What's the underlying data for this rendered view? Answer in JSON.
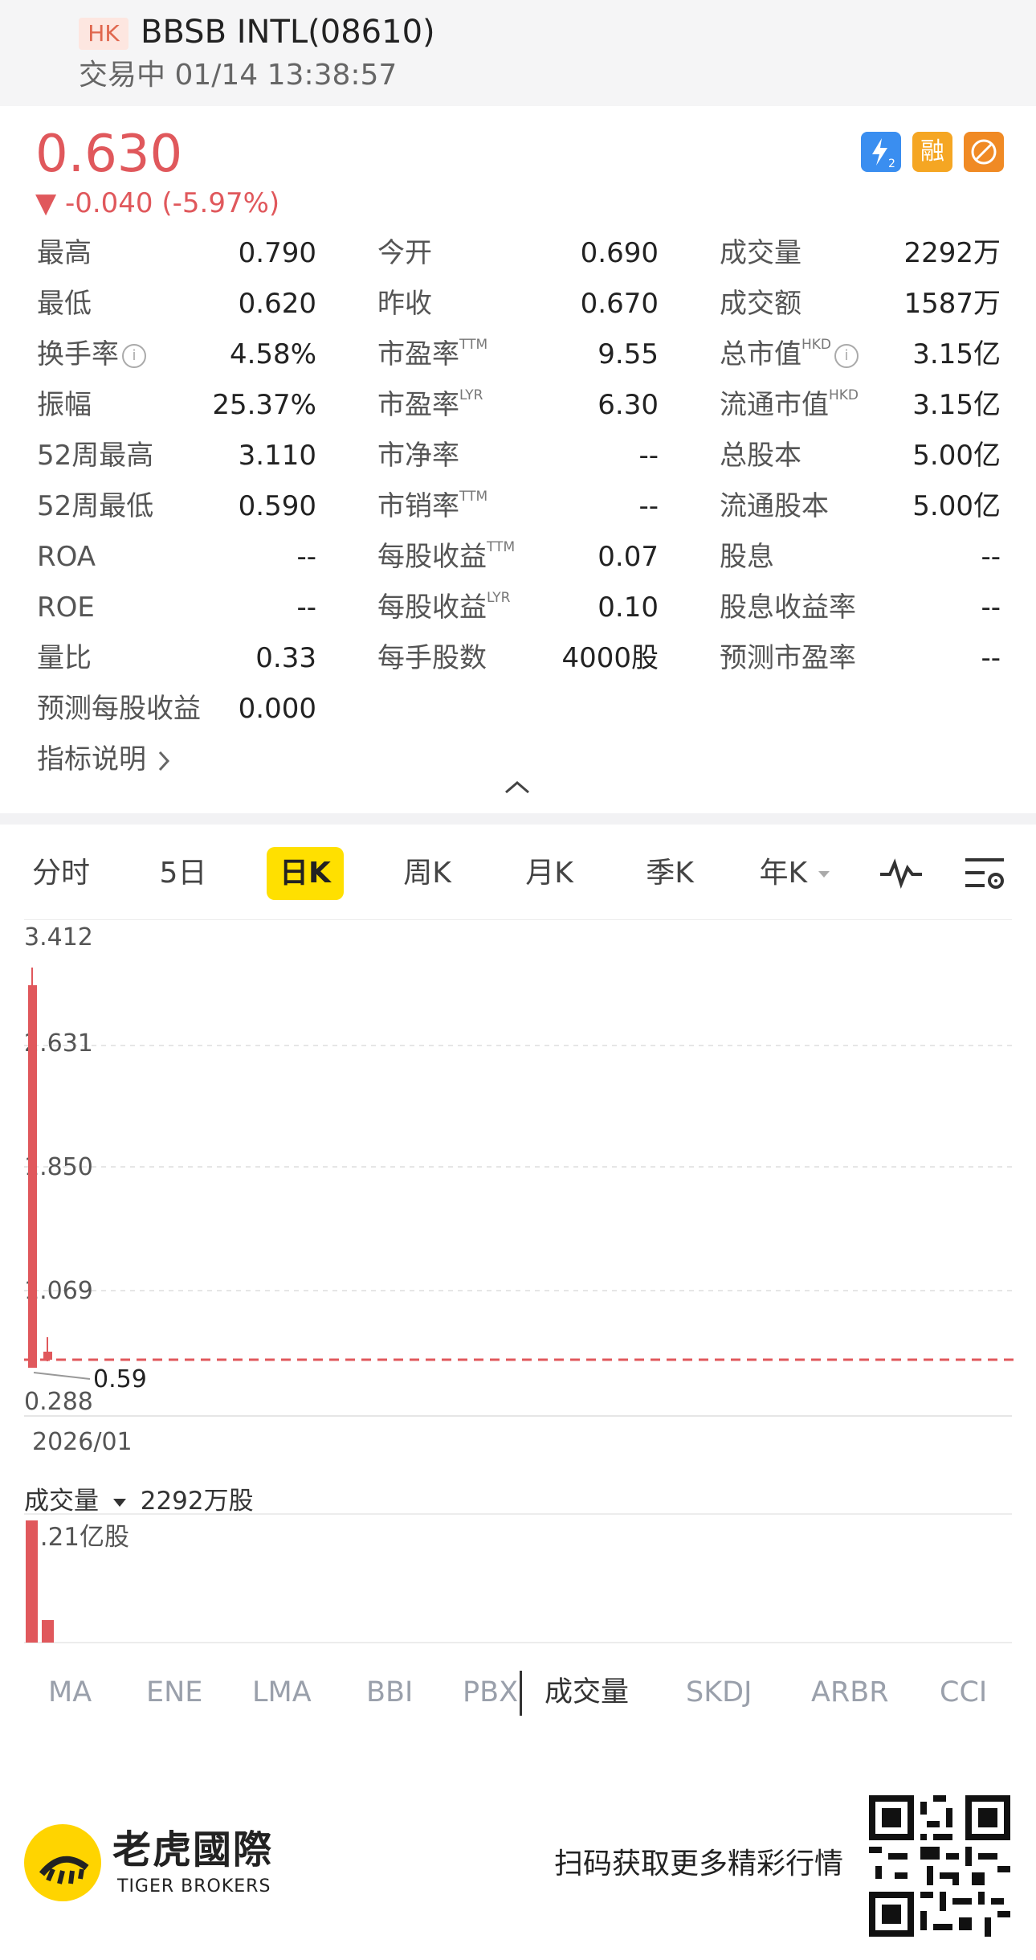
{
  "header": {
    "market_badge": "HK",
    "title": "BBSB INTL(08610)",
    "status_time": "交易中 01/14 13:38:57"
  },
  "quote": {
    "price": "0.630",
    "change": "▼ -0.040 (-5.97%)",
    "color_down": "#e0585c",
    "icons": [
      "level2-icon",
      "margin-icon",
      "no-short-icon"
    ],
    "icon_texts": {
      "margin": "融"
    }
  },
  "stats": [
    [
      {
        "label": "最高",
        "value": "0.790"
      },
      {
        "label": "今开",
        "value": "0.690"
      },
      {
        "label": "成交量",
        "value": "2292万"
      }
    ],
    [
      {
        "label": "最低",
        "value": "0.620"
      },
      {
        "label": "昨收",
        "value": "0.670"
      },
      {
        "label": "成交额",
        "value": "1587万"
      }
    ],
    [
      {
        "label": "换手率",
        "value": "4.58%",
        "info": true
      },
      {
        "label": "市盈率",
        "sup": "TTM",
        "value": "9.55"
      },
      {
        "label": "总市值",
        "sup": "HKD",
        "value": "3.15亿",
        "info": true
      }
    ],
    [
      {
        "label": "振幅",
        "value": "25.37%"
      },
      {
        "label": "市盈率",
        "sup": "LYR",
        "value": "6.30"
      },
      {
        "label": "流通市值",
        "sup": "HKD",
        "value": "3.15亿"
      }
    ],
    [
      {
        "label": "52周最高",
        "value": "3.110"
      },
      {
        "label": "市净率",
        "value": "--"
      },
      {
        "label": "总股本",
        "value": "5.00亿"
      }
    ],
    [
      {
        "label": "52周最低",
        "value": "0.590"
      },
      {
        "label": "市销率",
        "sup": "TTM",
        "value": "--"
      },
      {
        "label": "流通股本",
        "value": "5.00亿"
      }
    ],
    [
      {
        "label": "ROA",
        "value": "--"
      },
      {
        "label": "每股收益",
        "sup": "TTM",
        "value": "0.07"
      },
      {
        "label": "股息",
        "value": "--"
      }
    ],
    [
      {
        "label": "ROE",
        "value": "--"
      },
      {
        "label": "每股收益",
        "sup": "LYR",
        "value": "0.10"
      },
      {
        "label": "股息收益率",
        "value": "--"
      }
    ],
    [
      {
        "label": "量比",
        "value": "0.33"
      },
      {
        "label": "每手股数",
        "value": "4000股"
      },
      {
        "label": "预测市盈率",
        "value": "--"
      }
    ],
    [
      {
        "label": "预测每股收益",
        "value": "0.000"
      }
    ]
  ],
  "explain_link": "指标说明",
  "tabs": [
    "分时",
    "5日",
    "日K",
    "周K",
    "月K",
    "季K",
    "年K"
  ],
  "active_tab": "日K",
  "chart": {
    "y_ticks": [
      "3.412",
      "2.631",
      "1.850",
      "1.069",
      "0.288"
    ],
    "low_marker": "0.59",
    "x_label": "2026/01",
    "prev_close_line": 0.67
  },
  "volume": {
    "label": "成交量",
    "value": "2292万股",
    "max_label": "1.21亿股"
  },
  "indicators": [
    "MA",
    "ENE",
    "LMA",
    "BBI",
    "PBX",
    "成交量",
    "SKDJ",
    "ARBR",
    "CCI"
  ],
  "active_indicator": "成交量",
  "footer": {
    "logo_cn": "老虎國際",
    "logo_en": "TIGER BROKERS",
    "promo": "扫码获取更多精彩行情"
  }
}
